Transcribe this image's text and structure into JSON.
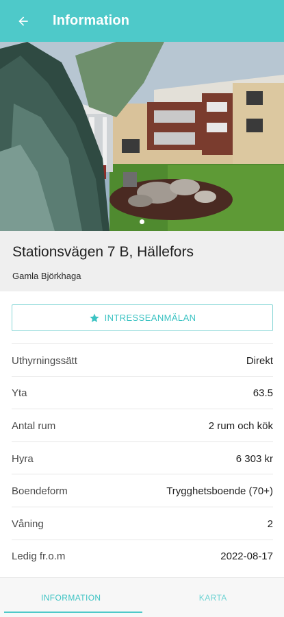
{
  "appbar": {
    "title": "Information",
    "back_icon": "arrow-left-icon"
  },
  "listing": {
    "address": "Stationsvägen 7 B, Hällefors",
    "area_name": "Gamla Björkhaga"
  },
  "gallery": {
    "total_images": 1,
    "current_index": 1
  },
  "interest_button": {
    "label": "INTRESSEANMÄLAN",
    "icon": "star-icon"
  },
  "details": [
    {
      "label": "Uthyrningssätt",
      "value": "Direkt"
    },
    {
      "label": "Yta",
      "value": "63.5"
    },
    {
      "label": "Antal rum",
      "value": "2 rum och kök"
    },
    {
      "label": "Hyra",
      "value": "6 303 kr"
    },
    {
      "label": "Boendeform",
      "value": "Trygghetsboende (70+)"
    },
    {
      "label": "Våning",
      "value": "2"
    },
    {
      "label": "Ledig fr.o.m",
      "value": "2022-08-17"
    }
  ],
  "tabs": [
    {
      "label": "INFORMATION",
      "active": true
    },
    {
      "label": "KARTA",
      "active": false
    }
  ],
  "colors": {
    "accent": "#4ec9c9",
    "accent_text": "#3cc3c3",
    "address_bg": "#efefef"
  }
}
